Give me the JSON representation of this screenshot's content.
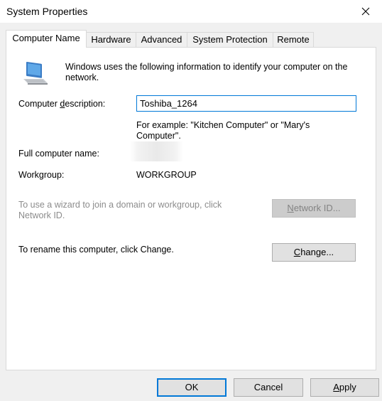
{
  "window": {
    "title": "System Properties"
  },
  "tabs": [
    {
      "label": "Computer Name",
      "active": true
    },
    {
      "label": "Hardware"
    },
    {
      "label": "Advanced"
    },
    {
      "label": "System Protection"
    },
    {
      "label": "Remote"
    }
  ],
  "panel": {
    "icon": "computer-monitor-icon",
    "intro_text": "Windows uses the following information to identify your computer on the network.",
    "description_label_pre": "Computer ",
    "description_label_accel": "d",
    "description_label_post": "escription:",
    "description_value": "Toshiba_1264",
    "example_text": "For example: \"Kitchen Computer\" or \"Mary's Computer\".",
    "full_name_label": "Full computer name:",
    "workgroup_label": "Workgroup:",
    "workgroup_value": "WORKGROUP",
    "wizard_text": "To use a wizard to join a domain or workgroup, click Network ID.",
    "network_id_accel": "N",
    "network_id_rest": "etwork ID...",
    "rename_text": "To rename this computer, click Change.",
    "change_accel": "C",
    "change_rest": "hange..."
  },
  "footer": {
    "ok_label": "OK",
    "cancel_label": "Cancel",
    "apply_accel": "A",
    "apply_rest": "pply"
  },
  "colors": {
    "focus_blue": "#0078d7",
    "disabled_text": "#8c8c8c"
  }
}
